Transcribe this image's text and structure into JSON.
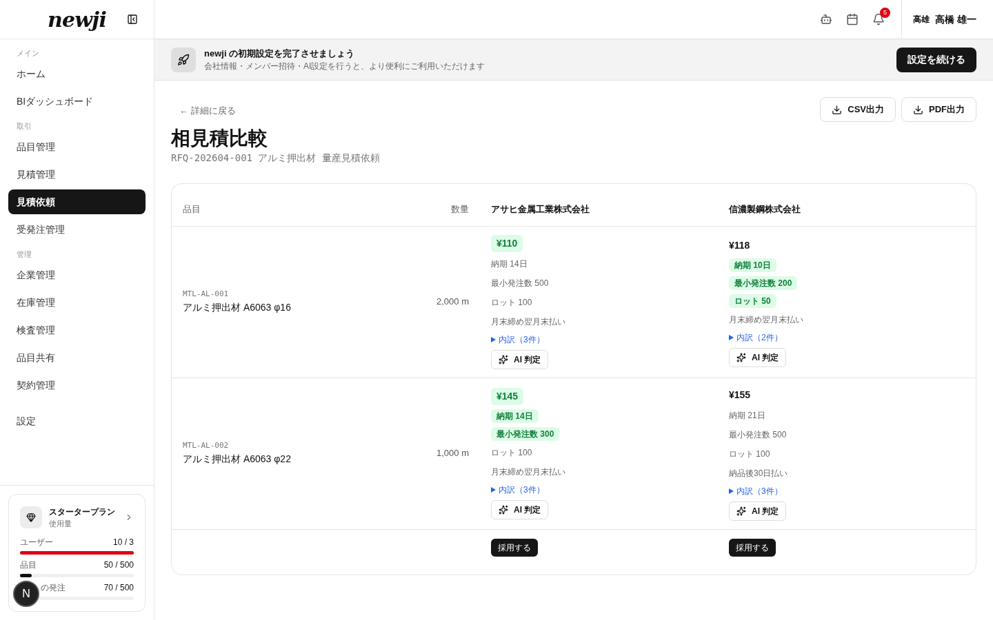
{
  "sidebar": {
    "logo": "newji",
    "sections": [
      {
        "label": "メイン",
        "items": [
          {
            "label": "ホーム",
            "selected": false
          },
          {
            "label": "BIダッシュボード",
            "selected": false
          }
        ]
      },
      {
        "label": "取引",
        "items": [
          {
            "label": "品目管理",
            "selected": false
          },
          {
            "label": "見積管理",
            "selected": false
          },
          {
            "label": "見積依頼",
            "selected": true
          },
          {
            "label": "受発注管理",
            "selected": false
          }
        ]
      },
      {
        "label": "管理",
        "items": [
          {
            "label": "企業管理",
            "selected": false
          },
          {
            "label": "在庫管理",
            "selected": false
          },
          {
            "label": "検査管理",
            "selected": false
          },
          {
            "label": "品目共有",
            "selected": false
          },
          {
            "label": "契約管理",
            "selected": false
          }
        ]
      }
    ],
    "settings": {
      "label": "設定",
      "selected": false
    },
    "plan": {
      "name": "スタータープラン",
      "subtitle": "使用量",
      "usage": [
        {
          "label": "ユーザー",
          "value": "10 / 3",
          "level": 1,
          "over_limit": true
        },
        {
          "label": "品目",
          "value": "50 / 500",
          "level": 0.1,
          "over_limit": false
        },
        {
          "label": "の発注",
          "value": "70 / 500"
        }
      ]
    },
    "floating_avatar": "N"
  },
  "header": {
    "notification_count": "5",
    "user_initials": "高雄",
    "user_name": "高橋 雄一"
  },
  "banner": {
    "title": "newji の初期設定を完了させましょう",
    "subtitle": "会社情報・メンバー招待・AI設定を行うと、より便利にご利用いただけます",
    "button": "設定を続ける"
  },
  "page": {
    "back_link": "← 詳細に戻る",
    "export_buttons": [
      "CSV出力",
      "PDF出力"
    ],
    "title": "相見積比較",
    "subtitle": "RFQ-202604-001 アルミ押出材 量産見積依頼"
  },
  "table": {
    "columns": [
      "品目",
      "数量",
      "アサヒ金属工業株式会社",
      "信濃製鋼株式会社"
    ],
    "rows": [
      {
        "code": "MTL-AL-001",
        "name": "アルミ押出材 A6063 φ16",
        "quantity": "2,000 m",
        "quotes": [
          {
            "price": "¥110",
            "best": true,
            "terms": [
              {
                "text": "納期 14日",
                "best": false
              },
              {
                "text": "最小発注数 500",
                "best": false
              },
              {
                "text": "ロット 100",
                "best": false
              },
              {
                "text": "月末締め翌月末払い",
                "best": false
              }
            ],
            "breakdown": "内訳（3件）",
            "ai_button": "AI 判定"
          },
          {
            "price": "¥118",
            "best": false,
            "terms": [
              {
                "text": "納期 10日",
                "best": true
              },
              {
                "text": "最小発注数 200",
                "best": true
              },
              {
                "text": "ロット 50",
                "best": true
              },
              {
                "text": "月末締め翌月末払い",
                "best": false
              }
            ],
            "breakdown": "内訳（2件）",
            "ai_button": "AI 判定"
          }
        ]
      },
      {
        "code": "MTL-AL-002",
        "name": "アルミ押出材 A6063 φ22",
        "quantity": "1,000 m",
        "quotes": [
          {
            "price": "¥145",
            "best": true,
            "terms": [
              {
                "text": "納期 14日",
                "best": true
              },
              {
                "text": "最小発注数 300",
                "best": true
              },
              {
                "text": "ロット 100",
                "best": false
              },
              {
                "text": "月末締め翌月末払い",
                "best": false
              }
            ],
            "breakdown": "内訳（3件）",
            "ai_button": "AI 判定"
          },
          {
            "price": "¥155",
            "best": false,
            "terms": [
              {
                "text": "納期 21日",
                "best": false
              },
              {
                "text": "最小発注数 500",
                "best": false
              },
              {
                "text": "ロット 100",
                "best": false
              },
              {
                "text": "納品後30日払い",
                "best": false
              }
            ],
            "breakdown": "内訳（3件）",
            "ai_button": "AI 判定"
          }
        ]
      }
    ],
    "adopt_buttons": [
      "採用する",
      "採用する"
    ]
  }
}
